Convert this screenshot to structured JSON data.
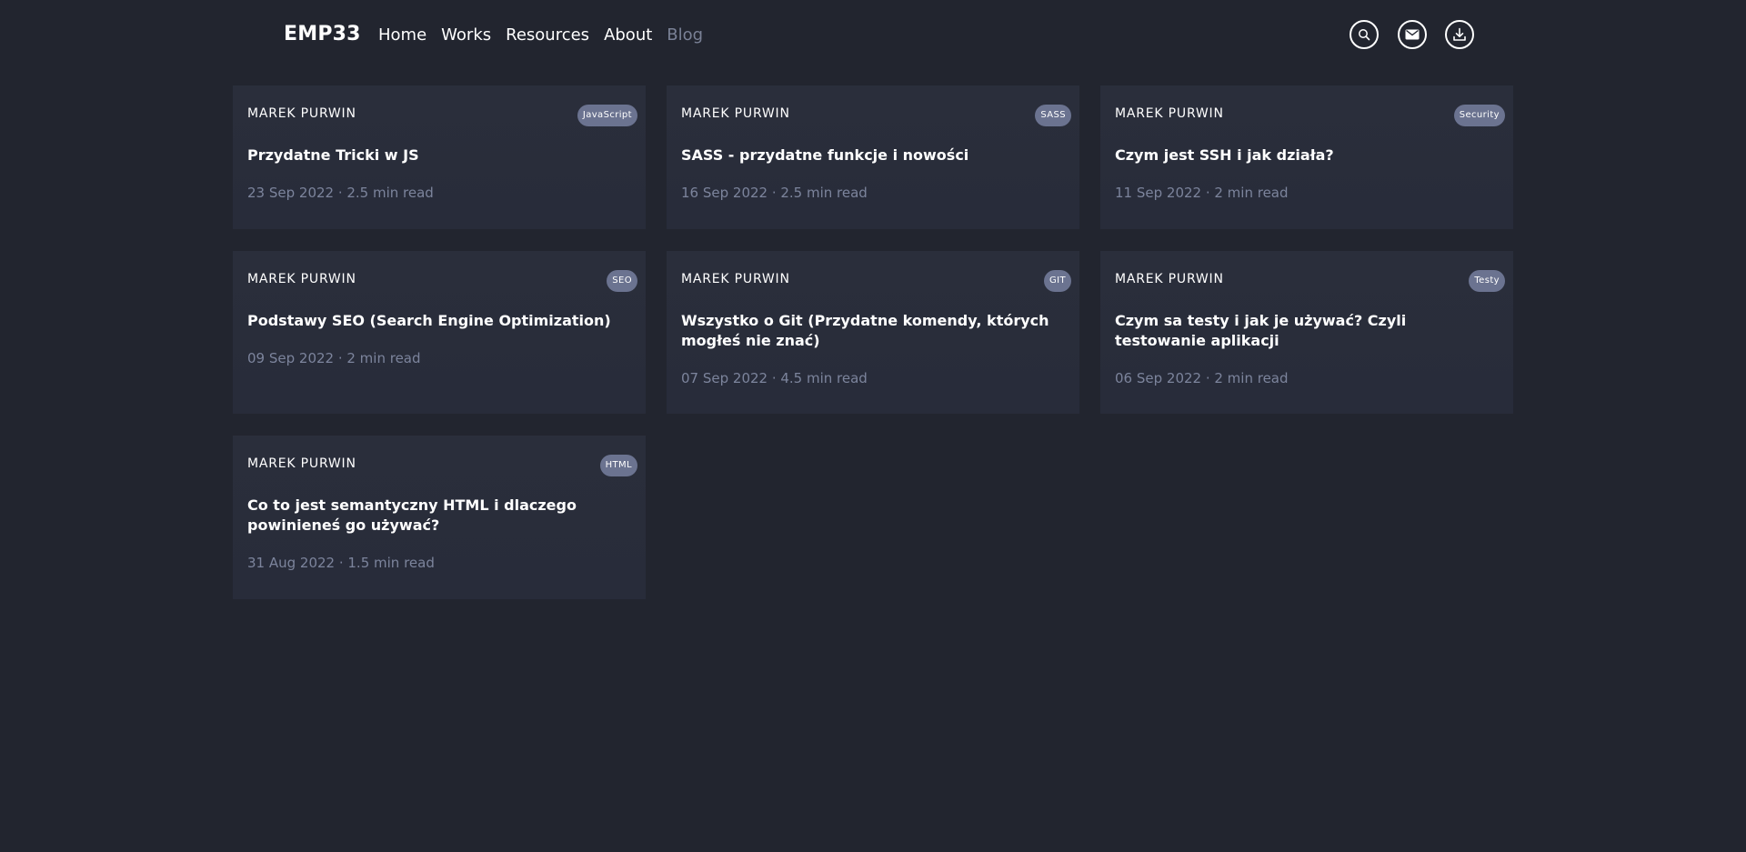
{
  "header": {
    "logo": "EMP33",
    "nav": [
      {
        "label": "Home"
      },
      {
        "label": "Works"
      },
      {
        "label": "Resources"
      },
      {
        "label": "About"
      },
      {
        "label": "Blog",
        "active": true
      }
    ],
    "icons": [
      "search-icon",
      "mail-icon",
      "download-icon"
    ]
  },
  "posts": [
    {
      "author": "MAREK PURWIN",
      "tag": "JavaScript",
      "title": "Przydatne Tricki w JS",
      "date": "23 Sep 2022",
      "read": "2.5 min read",
      "meta": "23 Sep 2022 · 2.5 min read"
    },
    {
      "author": "MAREK PURWIN",
      "tag": "SASS",
      "title": "SASS - przydatne funkcje i nowości",
      "date": "16 Sep 2022",
      "read": "2.5 min read",
      "meta": "16 Sep 2022 · 2.5 min read"
    },
    {
      "author": "MAREK PURWIN",
      "tag": "Security",
      "title": "Czym jest SSH i jak działa?",
      "date": "11 Sep 2022",
      "read": "2 min read",
      "meta": "11 Sep 2022 · 2 min read"
    },
    {
      "author": "MAREK PURWIN",
      "tag": "SEO",
      "title": "Podstawy SEO (Search Engine Optimization)",
      "date": "09 Sep 2022",
      "read": "2 min read",
      "meta": "09 Sep 2022 · 2 min read"
    },
    {
      "author": "MAREK PURWIN",
      "tag": "GIT",
      "title": "Wszystko o Git (Przydatne komendy, których mogłeś nie znać)",
      "date": "07 Sep 2022",
      "read": "4.5 min read",
      "meta": "07 Sep 2022 · 4.5 min read"
    },
    {
      "author": "MAREK PURWIN",
      "tag": "Testy",
      "title": "Czym sa testy i jak je używać? Czyli testowanie aplikacji",
      "date": "06 Sep 2022",
      "read": "2 min read",
      "meta": "06 Sep 2022 · 2 min read"
    },
    {
      "author": "MAREK PURWIN",
      "tag": "HTML",
      "title": "Co to jest semantyczny HTML i dlaczego powinieneś go używać?",
      "date": "31 Aug 2022",
      "read": "1.5 min read",
      "meta": "31 Aug 2022 · 1.5 min read"
    }
  ]
}
